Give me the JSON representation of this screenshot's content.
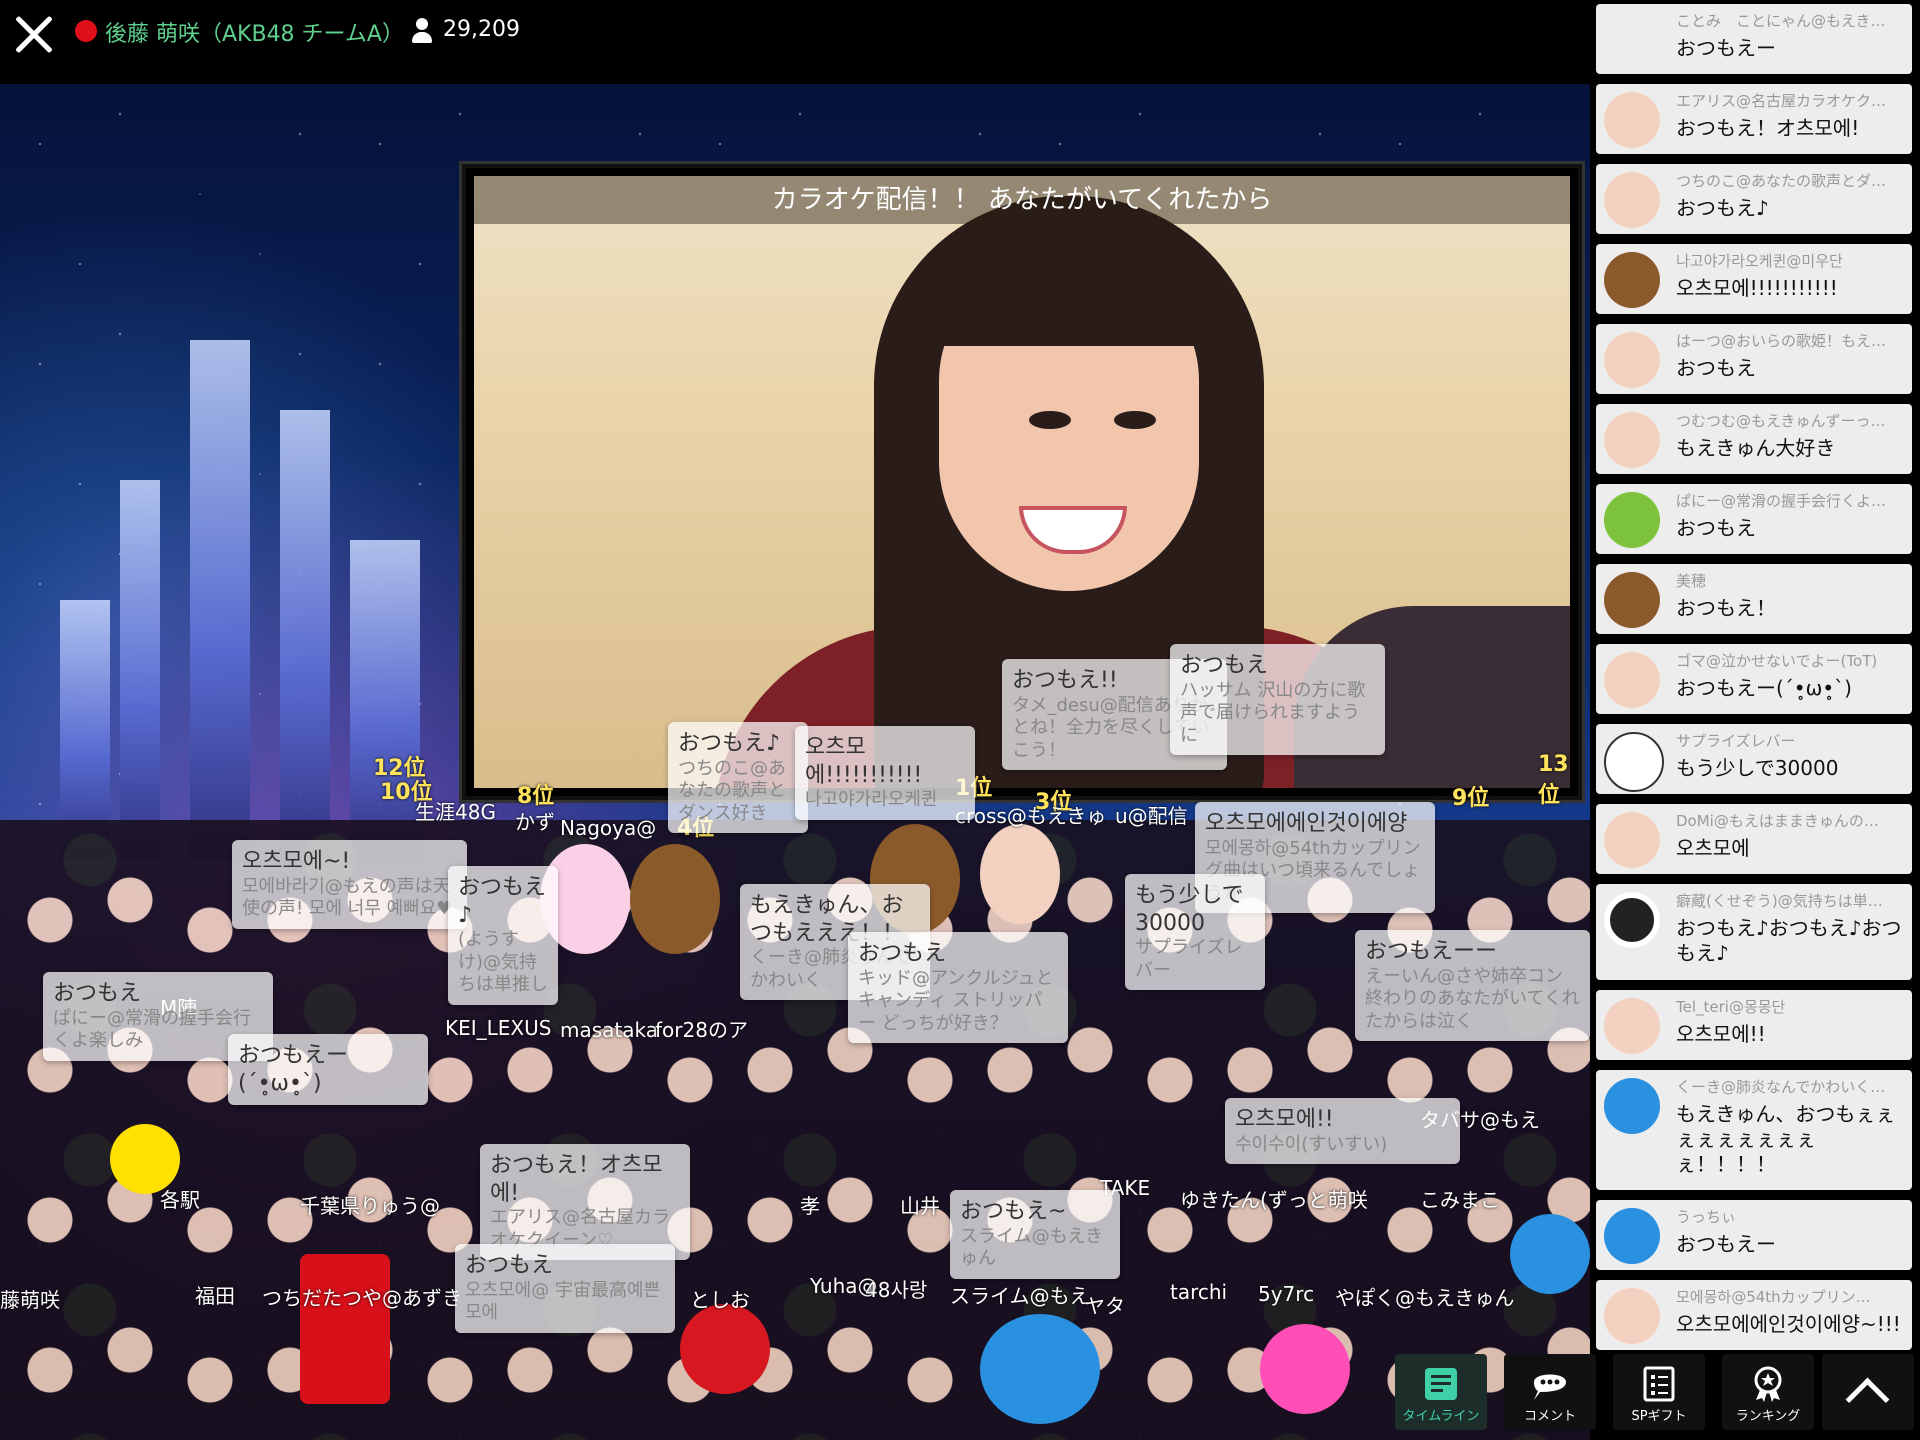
{
  "header": {
    "streamer_name": "後藤 萌咲（AKB48 チームA）",
    "viewer_count": "29,209"
  },
  "video": {
    "title": "カラオケ配信！！ あなたがいてくれたから"
  },
  "overlay": {
    "floats": [
      {
        "text": "おつもえ!!",
        "sub": "タメ_desu@配信ありがとね！全力を尽くしていこう！"
      },
      {
        "text": "おつもえ",
        "sub": "ハッサム 沢山の方に歌声で届けられますように"
      },
      {
        "text": "おつもえ♪",
        "sub": "つちのこ@あなたの歌声とダンス好き"
      },
      {
        "text": "오츠모에!!!!!!!!!!!",
        "sub": "나고야가라오케퀸"
      },
      {
        "text": "오츠모에~!",
        "sub": "모에바라기@もえの声は天使の声! 모에 너무 예뻐요♥"
      },
      {
        "text": "おつもえ♪",
        "sub": "(ようすけ)@気持ちは単推し"
      },
      {
        "text": "오츠모에에인것이에양",
        "sub": "모에몽하@54thカップリング曲はいつ頃来るんでしょうか"
      },
      {
        "text": "おつもえ",
        "sub": "ぱにー@常滑の握手会行くよ楽しみ"
      },
      {
        "text": "おつもえー(´•̥ω•̥`)",
        "sub": ""
      },
      {
        "text": "もえきゅん、おつもえええ！！",
        "sub": "くーき@肺炎なんでかわいく"
      },
      {
        "text": "おつもえ",
        "sub": "キッド@アンクルジュとキャンディ ストリッパー どっちが好き？"
      },
      {
        "text": "もう少しで30000",
        "sub": "サプライズレバー"
      },
      {
        "text": "おつもえーー",
        "sub": "えーいん@さや姉卒コン終わりのあなたがいてくれたからは泣く"
      },
      {
        "text": "おつもえ！オ츠모에!",
        "sub": "エアリス@名古屋カラオケクイーン♡"
      },
      {
        "text": "오츠모에!!",
        "sub": "수이수이(すいすい)"
      },
      {
        "text": "おつもえ",
        "sub": "오츠모에@ 宇宙最高예쁜 모에"
      },
      {
        "text": "おつもえ~",
        "sub": "スライム@もえきゅん"
      }
    ],
    "ranks": [
      "12位",
      "10位",
      "8位",
      "4位",
      "1位",
      "3位",
      "9位",
      "13位"
    ],
    "names": [
      "生涯48G",
      "かず",
      "Nagoya@",
      "cross@もえきゅ",
      "u@配信",
      "KEI_LEXUS",
      "masataka",
      "for28のア",
      "各駅",
      "千葉県りゅう@",
      "孝",
      "山井",
      "ゆきたん(ずっと萌咲",
      "こみまこ",
      "藤萌咲",
      "福田",
      "つちだたつや@あずき",
      "としお",
      "Yuha@",
      "48사랑",
      "スライム@もえ",
      "ヤタ",
      "tarchi",
      "5y7rc",
      "やぽく@もえきゅん",
      "M陣",
      "TAKE",
      "タバサ@もえ"
    ]
  },
  "feed": [
    {
      "avatar": "panda-girl",
      "name": "ことみ　ことにゃん@もえき…",
      "text": "おつもえー"
    },
    {
      "avatar": "moe-girl",
      "name": "エアリス@名古屋カラオケク…",
      "text": "おつもえ！オ츠모에!"
    },
    {
      "avatar": "moe-girl",
      "name": "つちのこ@あなたの歌声とダ…",
      "text": "おつもえ♪"
    },
    {
      "avatar": "bear",
      "name": "나고야가라오케퀸@미우단",
      "text": "오츠모에!!!!!!!!!!!"
    },
    {
      "avatar": "moe-girl",
      "name": "はーつ@おいらの歌姫！もえ…",
      "text": "おつもえ"
    },
    {
      "avatar": "moe-girl",
      "name": "つむつむ@もえきゅんずーっ…",
      "text": "もえきゅん大好き"
    },
    {
      "avatar": "lion",
      "name": "ぱにー@常滑の握手会行くよ…",
      "text": "おつもえ"
    },
    {
      "avatar": "cheburashka",
      "name": "美穂",
      "text": "おつもえ！"
    },
    {
      "avatar": "moe-girl",
      "name": "ゴマ@泣かせないでよー(ToT)",
      "text": "おつもえー(´•̥ω•̥`)"
    },
    {
      "avatar": "cat",
      "name": "サプライズレバー",
      "text": "もう少しで30000"
    },
    {
      "avatar": "moe-girl",
      "name": "DoMi@もえはままきゅんの…",
      "text": "오츠모에"
    },
    {
      "avatar": "panda",
      "name": "癖蔵(くせぞう)@気持ちは単…",
      "text": "おつもえ♪おつもえ♪おつもえ♪"
    },
    {
      "avatar": "moe-girl",
      "name": "Tel_teri@몽몽단",
      "text": "오츠모에!!"
    },
    {
      "avatar": "blue-mascot",
      "name": "くーき@肺炎なんでかわいく…",
      "text": "もえきゅん、おつもぇぇぇぇぇぇぇぇぇぇ！！！！"
    },
    {
      "avatar": "blue-mascot",
      "name": "うっちぃ",
      "text": "おつもえー"
    },
    {
      "avatar": "moe-girl",
      "name": "모에몽하@54thカップリン…",
      "text": "오츠모에에인것이에양~!!!"
    }
  ],
  "nav": {
    "timeline": "タイムライン",
    "comment": "コメント",
    "spgift": "SPギフト",
    "ranking": "ランキング"
  },
  "colors": {
    "accent": "#3fd0a8",
    "live": "#e0101a",
    "name": "#5fd08d",
    "rank": "#ffe35a"
  }
}
